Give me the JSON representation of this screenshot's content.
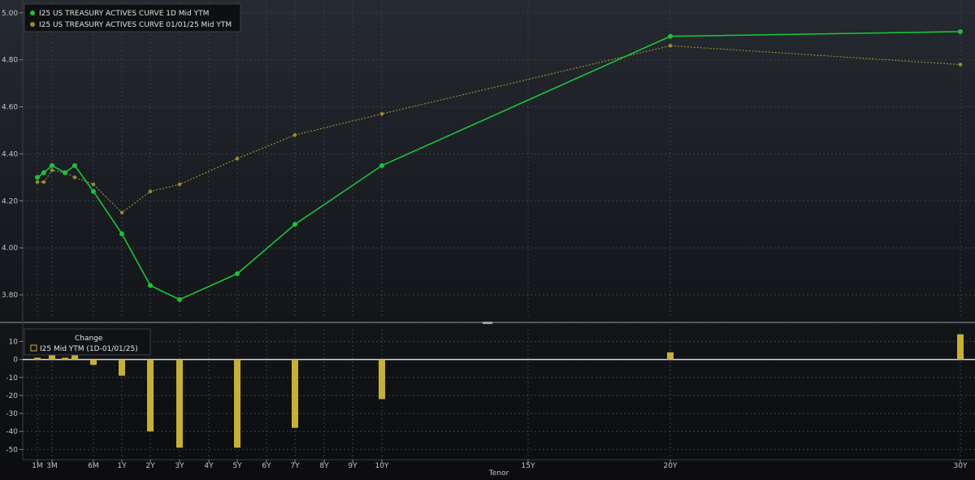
{
  "chart_data": [
    {
      "type": "line",
      "legend_position": "top-left",
      "grid": true,
      "x_tick_labels": [
        "1M",
        "3M",
        "6M",
        "1Y",
        "2Y",
        "3Y",
        "4Y",
        "5Y",
        "6Y",
        "7Y",
        "8Y",
        "9Y",
        "10Y",
        "15Y",
        "20Y",
        "30Y"
      ],
      "y_tick_labels": [
        "5.00",
        "4.80",
        "4.60",
        "4.40",
        "4.20",
        "4.00",
        "3.80"
      ],
      "ylim": [
        3.7,
        5.02
      ],
      "series": [
        {
          "name": "I25 US TREASURY ACTIVES CURVE 1D Mid YTM",
          "color": "#19c43a",
          "points": [
            [
              "1M",
              4.3
            ],
            [
              "2M",
              4.32
            ],
            [
              "3M",
              4.35
            ],
            [
              "4M",
              4.32
            ],
            [
              "5M",
              4.35
            ],
            [
              "6M",
              4.24
            ],
            [
              "1Y",
              4.06
            ],
            [
              "2Y",
              3.84
            ],
            [
              "3Y",
              3.78
            ],
            [
              "5Y",
              3.89
            ],
            [
              "7Y",
              4.1
            ],
            [
              "10Y",
              4.35
            ],
            [
              "20Y",
              4.9
            ],
            [
              "30Y",
              4.92
            ]
          ]
        },
        {
          "name": "I25 US TREASURY ACTIVES CURVE 01/01/25 Mid YTM",
          "color": "#9a8a2e",
          "points": [
            [
              "1M",
              4.28
            ],
            [
              "2M",
              4.28
            ],
            [
              "3M",
              4.33
            ],
            [
              "4M",
              4.32
            ],
            [
              "5M",
              4.3
            ],
            [
              "6M",
              4.27
            ],
            [
              "1Y",
              4.15
            ],
            [
              "2Y",
              4.24
            ],
            [
              "3Y",
              4.27
            ],
            [
              "5Y",
              4.38
            ],
            [
              "7Y",
              4.48
            ],
            [
              "10Y",
              4.57
            ],
            [
              "20Y",
              4.86
            ],
            [
              "30Y",
              4.78
            ]
          ]
        }
      ]
    },
    {
      "type": "bar",
      "title": "Change",
      "legend": "I25 Mid YTM (1D-01/01/25)",
      "color": "#c8b033",
      "xlabel": "Tenor",
      "y_tick_labels": [
        "10",
        "0",
        "-10",
        "-20",
        "-30",
        "-40",
        "-50"
      ],
      "ylim": [
        -53,
        17
      ],
      "points": [
        [
          "1M",
          1
        ],
        [
          "3M",
          5
        ],
        [
          "4M",
          1
        ],
        [
          "5M",
          5
        ],
        [
          "6M",
          -3
        ],
        [
          "1Y",
          -9
        ],
        [
          "2Y",
          -40
        ],
        [
          "3Y",
          -49
        ],
        [
          "5Y",
          -49
        ],
        [
          "7Y",
          -38
        ],
        [
          "10Y",
          -22
        ],
        [
          "20Y",
          4
        ],
        [
          "30Y",
          14
        ]
      ]
    }
  ]
}
